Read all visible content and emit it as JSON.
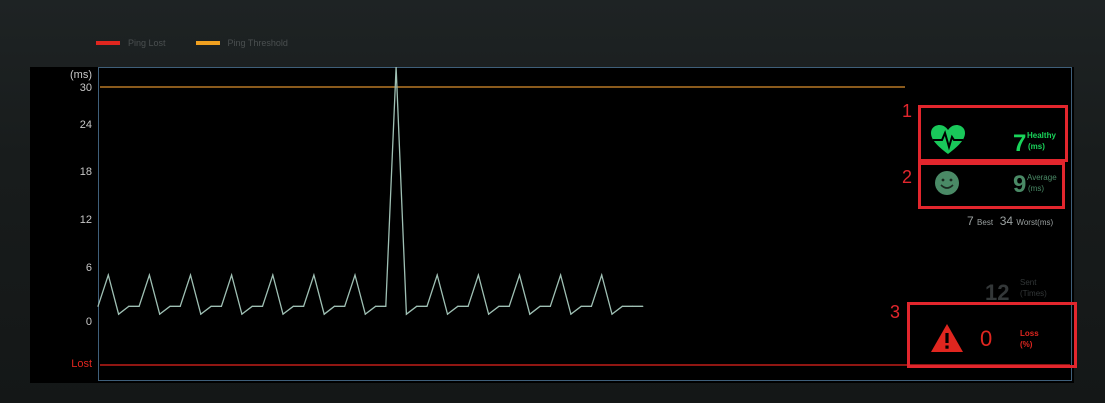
{
  "legend": {
    "items": [
      {
        "label": "Ping Lost",
        "color": "#e0261f"
      },
      {
        "label": "Ping Threshold",
        "color": "#f0a020"
      }
    ]
  },
  "chart_data": {
    "type": "line",
    "ylabel": "(ms)",
    "yticks": [
      "30",
      "24",
      "18",
      "12",
      "6",
      "0"
    ],
    "ylim": [
      0,
      30
    ],
    "lost_label": "Lost",
    "threshold_ms": 30,
    "series": [
      {
        "color": "#9fc0b4",
        "values": [
          2,
          6,
          1,
          2,
          2,
          6,
          1,
          2,
          2,
          6,
          1,
          2,
          2,
          6,
          1,
          2,
          2,
          6,
          1,
          2,
          2,
          6,
          1,
          2,
          2,
          6,
          1,
          2,
          2,
          35,
          1,
          2,
          2,
          6,
          1,
          2,
          2,
          6,
          1,
          2,
          2,
          6,
          1,
          2,
          2,
          6,
          1,
          2,
          2,
          6,
          1,
          2,
          2,
          2
        ]
      }
    ]
  },
  "markers": [
    "1",
    "2",
    "3"
  ],
  "healthy": {
    "value": "7",
    "label_top": "Healthy",
    "label_bottom": "(ms)",
    "icon": "heart-pulse-icon",
    "color": "#19d45a"
  },
  "average": {
    "value": "9",
    "label_top": "Average",
    "label_bottom": "(ms)",
    "icon": "smiley-icon",
    "color": "#4a8a66"
  },
  "best_worst": {
    "best_value": "7",
    "best_label": "Best",
    "worst_value": "34",
    "worst_label": "Worst(ms)"
  },
  "sent": {
    "value": "12",
    "label_top": "Sent",
    "label_bottom": "(Times)"
  },
  "loss": {
    "value": "0",
    "label_top": "Loss",
    "label_bottom": "(%)",
    "icon": "warning-icon",
    "color": "#e0261f"
  }
}
